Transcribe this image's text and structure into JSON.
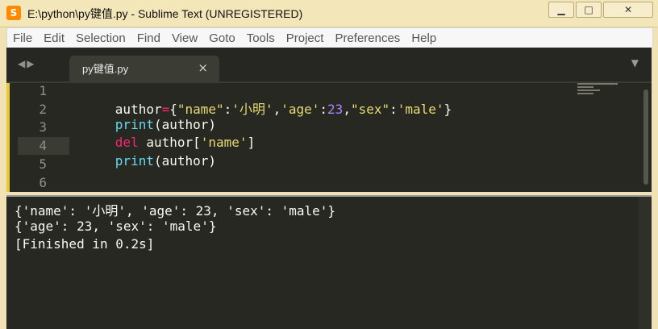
{
  "window": {
    "title": "E:\\python\\py键值.py - Sublime Text (UNREGISTERED)"
  },
  "menubar": {
    "items": [
      "File",
      "Edit",
      "Selection",
      "Find",
      "View",
      "Goto",
      "Tools",
      "Project",
      "Preferences",
      "Help"
    ]
  },
  "tab": {
    "label": "py键值.py",
    "close": "×"
  },
  "editor": {
    "line_numbers": [
      "1",
      "2",
      "3",
      "4",
      "5",
      "6"
    ],
    "tokens": {
      "l1": [
        "author",
        "=",
        "{",
        "\"name\"",
        ":",
        "'小明'",
        ",",
        "'age'",
        ":",
        "23",
        ",",
        "\"sex\"",
        ":",
        "'male'",
        "}"
      ],
      "l2": [
        "print",
        "(",
        "author",
        ")"
      ],
      "l3": [
        "del",
        " author[",
        "'name'",
        "]"
      ],
      "l4": [
        "print",
        "(",
        "author",
        ")"
      ]
    }
  },
  "console": {
    "lines": [
      "{'name': '小明', 'age': 23, 'sex': 'male'}",
      "{'age': 23, 'sex': 'male'}",
      "[Finished in 0.2s]"
    ]
  }
}
